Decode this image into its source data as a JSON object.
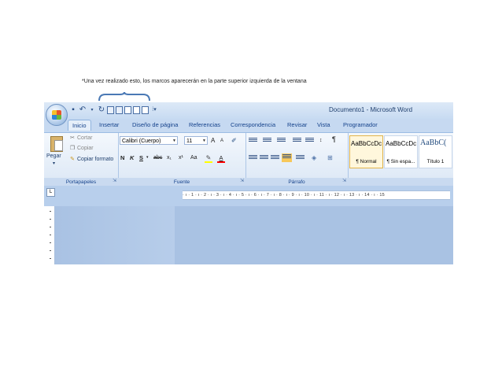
{
  "caption": "*Una vez realizado esto, los marcos aparecerán en la parte superior izquierda de la ventana",
  "window": {
    "title": "Documento1 - Microsoft Word"
  },
  "quick_access": {
    "icons": [
      "save-icon",
      "undo-icon",
      "redo-icon",
      "frame-icon",
      "frame-icon",
      "frame-icon",
      "frame-icon",
      "frame-icon",
      "customize-icon"
    ]
  },
  "tabs": [
    "Inicio",
    "Insertar",
    "Diseño de página",
    "Referencias",
    "Correspondencia",
    "Revisar",
    "Vista",
    "Programador"
  ],
  "active_tab": "Inicio",
  "clipboard": {
    "paste": "Pegar",
    "cut": "Cortar",
    "copy": "Copiar",
    "format_painter": "Copiar formato",
    "label": "Portapapeles"
  },
  "font": {
    "name": "Calibri (Cuerpo)",
    "size": "11",
    "grow": "A",
    "shrink": "A",
    "bold": "N",
    "italic": "K",
    "underline": "S",
    "strike": "abc",
    "subscript": "x₁",
    "superscript": "x¹",
    "case": "Aa",
    "highlight_color": "#ffff00",
    "font_color": "#ff0000",
    "label": "Fuente"
  },
  "paragraph": {
    "label": "Párrafo",
    "pilcrow": "¶"
  },
  "styles": [
    {
      "preview": "AaBbCcDc",
      "name": "¶ Normal"
    },
    {
      "preview": "AaBbCcDc",
      "name": "¶ Sin espa..."
    },
    {
      "preview": "AaBbC(",
      "name": "Título 1"
    }
  ],
  "ruler": {
    "text": "· ı · 1 · ı · 2 · ı · 3 · ı · 4 · ı · 5 · ı · 6 · ı · 7 · ı · 8 · ı · 9 · ı · 10 · ı · 11 · ı · 12 · ı · 13 · ı · 14 · ı · 15"
  },
  "colors": {
    "ribbon_blue": "#c6d9f1",
    "text_blue": "#15428b",
    "doc_bg": "#a9c2e3"
  }
}
